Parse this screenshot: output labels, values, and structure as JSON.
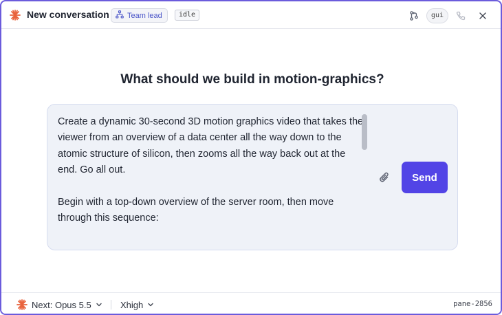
{
  "header": {
    "title": "New conversation",
    "role_label": "Team lead",
    "status": "idle",
    "mode": "gui"
  },
  "main": {
    "headline": "What should we build in motion-graphics?",
    "prompt_text": "Create a dynamic 30-second 3D motion graphics video that takes the viewer from an overview of a data center all the way down to the atomic structure of silicon, then zooms all the way back out at the end. Go all out.\n\nBegin with a top-down overview of the server room, then move through this sequence:",
    "send_label": "Send"
  },
  "footer": {
    "model_label": "Next: Opus 5.5",
    "effort_label": "Xhigh",
    "pane_id": "pane-2856"
  },
  "colors": {
    "accent": "#5244e6",
    "brand": "#e8623c",
    "window_border": "#6b5bdc"
  },
  "icons": {
    "logo": "starburst-icon",
    "role": "org-chart-icon",
    "branch": "git-branch-icon",
    "phone": "phone-icon",
    "close": "close-icon",
    "attach": "paperclip-icon",
    "chevron": "chevron-down-icon"
  }
}
